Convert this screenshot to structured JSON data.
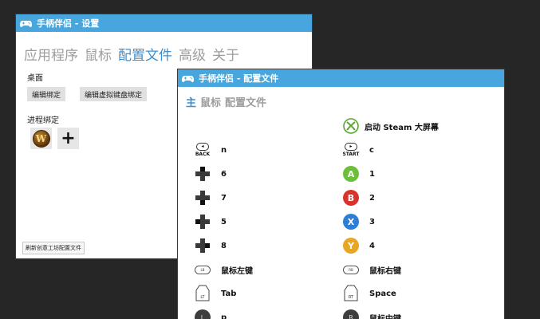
{
  "settings": {
    "title": "手柄伴侣 - 设置",
    "nav": [
      "应用程序",
      "鼠标",
      "配置文件",
      "高级",
      "关于"
    ],
    "nav_active_index": 2,
    "desktop_label": "桌面",
    "edit_binding_btn": "编辑绑定",
    "edit_virtual_keyboard_btn": "编辑虚拟键盘绑定",
    "process_binding_label": "进程绑定",
    "process_icon_glyph": "W",
    "add_glyph": "+",
    "refresh_btn": "刷新创意工坊配置文件"
  },
  "profile": {
    "title": "手柄伴侣 - 配置文件",
    "nav": [
      "主",
      "鼠标",
      "配置文件"
    ],
    "nav_active_index": 0,
    "steam_label": "启动 Steam 大屏幕",
    "left": [
      {
        "kind": "back",
        "cap": "BACK",
        "label": "n"
      },
      {
        "kind": "dpad-up",
        "label": "6"
      },
      {
        "kind": "dpad-down",
        "label": "7"
      },
      {
        "kind": "dpad-left",
        "label": "5"
      },
      {
        "kind": "dpad-right",
        "label": "8"
      },
      {
        "kind": "lb",
        "cap": "LB",
        "label": "鼠标左键"
      },
      {
        "kind": "lt",
        "cap": "LT",
        "label": "Tab"
      },
      {
        "kind": "ls",
        "cap": "L",
        "label": "p"
      }
    ],
    "right": [
      {
        "kind": "start",
        "cap": "START",
        "label": "c"
      },
      {
        "kind": "face",
        "glyph": "A",
        "color": "#6bbf3a",
        "label": "1"
      },
      {
        "kind": "face",
        "glyph": "B",
        "color": "#d9342b",
        "label": "2"
      },
      {
        "kind": "face",
        "glyph": "X",
        "color": "#2d7fd6",
        "label": "3"
      },
      {
        "kind": "face",
        "glyph": "Y",
        "color": "#e8a622",
        "label": "4"
      },
      {
        "kind": "rb",
        "cap": "RB",
        "label": "鼠标右键"
      },
      {
        "kind": "rt",
        "cap": "RT",
        "label": "Space"
      },
      {
        "kind": "rs",
        "cap": "R",
        "label": "鼠标中键"
      }
    ]
  }
}
